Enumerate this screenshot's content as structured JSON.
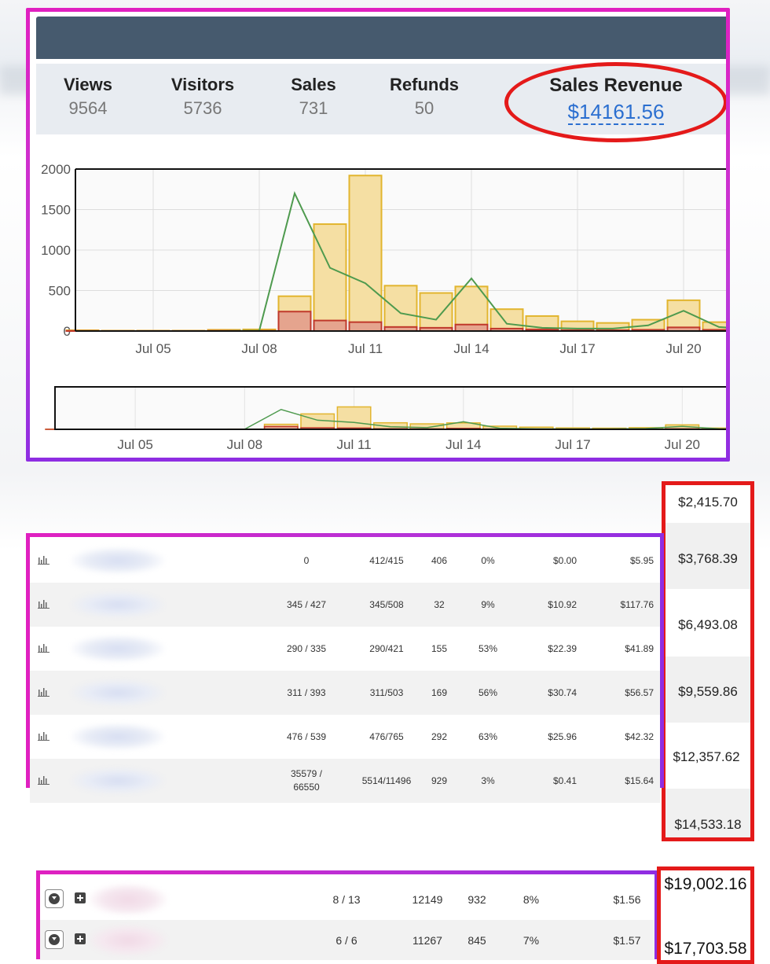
{
  "stats": [
    {
      "label": "Views",
      "value": "9564"
    },
    {
      "label": "Visitors",
      "value": "5736"
    },
    {
      "label": "Sales",
      "value": "731"
    },
    {
      "label": "Refunds",
      "value": "50"
    }
  ],
  "revenue": {
    "label": "Sales Revenue",
    "value": "$14161.56"
  },
  "colors": {
    "bar_fill": "#f5dfa3",
    "bar_stroke": "#e2b52f",
    "refund_fill": "#e5a48e",
    "refund_stroke": "#c0392b",
    "line": "#4e9a4e",
    "highlight": "#e41a1a",
    "header": "#465a6e",
    "accent_link": "#2b6fd0"
  },
  "chart_data": {
    "type": "bar",
    "y_ticks": [
      "0",
      "500",
      "1000",
      "1500",
      "2000"
    ],
    "ylim": [
      0,
      2000
    ],
    "x_ticks": [
      "Jul 05",
      "Jul 08",
      "Jul 11",
      "Jul 14",
      "Jul 17",
      "Jul 20"
    ],
    "categories": [
      "Jul 03",
      "Jul 04",
      "Jul 05",
      "Jul 06",
      "Jul 07",
      "Jul 08",
      "Jul 09",
      "Jul 10",
      "Jul 11",
      "Jul 12",
      "Jul 13",
      "Jul 14",
      "Jul 15",
      "Jul 16",
      "Jul 17",
      "Jul 18",
      "Jul 19",
      "Jul 20",
      "Jul 21",
      "Jul 22"
    ],
    "series": [
      {
        "kind": "bar",
        "values": [
          10,
          5,
          5,
          5,
          15,
          20,
          430,
          1320,
          1920,
          560,
          470,
          550,
          270,
          185,
          120,
          100,
          140,
          380,
          110,
          90
        ]
      },
      {
        "kind": "bar",
        "values": [
          2,
          1,
          1,
          1,
          3,
          3,
          240,
          130,
          110,
          50,
          40,
          80,
          30,
          20,
          10,
          10,
          15,
          45,
          15,
          10
        ]
      },
      {
        "kind": "line",
        "values": [
          0,
          0,
          0,
          0,
          0,
          5,
          1700,
          780,
          590,
          220,
          140,
          650,
          90,
          40,
          30,
          30,
          70,
          250,
          50,
          20
        ]
      }
    ]
  },
  "table1": {
    "rows": [
      {
        "c1": "0",
        "c2": "412/415",
        "c3": "406",
        "c4": "0%",
        "c5": "$0.00",
        "c6": "$5.95"
      },
      {
        "c1": "345 / 427",
        "c2": "345/508",
        "c3": "32",
        "c4": "9%",
        "c5": "$10.92",
        "c6": "$117.76"
      },
      {
        "c1": "290 / 335",
        "c2": "290/421",
        "c3": "155",
        "c4": "53%",
        "c5": "$22.39",
        "c6": "$41.89"
      },
      {
        "c1": "311 / 393",
        "c2": "311/503",
        "c3": "169",
        "c4": "56%",
        "c5": "$30.74",
        "c6": "$56.57"
      },
      {
        "c1": "476 / 539",
        "c2": "476/765",
        "c3": "292",
        "c4": "63%",
        "c5": "$25.96",
        "c6": "$42.32"
      },
      {
        "c1": "35579 / 66550",
        "c2": "5514/11496",
        "c3": "929",
        "c4": "3%",
        "c5": "$0.41",
        "c6": "$15.64"
      }
    ]
  },
  "revenue_column": [
    "$2,415.70",
    "$3,768.39",
    "$6,493.08",
    "$9,559.86",
    "$12,357.62",
    "$14,533.18"
  ],
  "table3": {
    "rows": [
      {
        "c1": "8 / 13",
        "c2": "12149",
        "c3": "932",
        "c4": "8%",
        "c5": "$1.56"
      },
      {
        "c1": "6 / 6",
        "c2": "11267",
        "c3": "845",
        "c4": "7%",
        "c5": "$1.57"
      }
    ]
  },
  "revenue_box": [
    "$19,002.16",
    "$17,703.58"
  ]
}
